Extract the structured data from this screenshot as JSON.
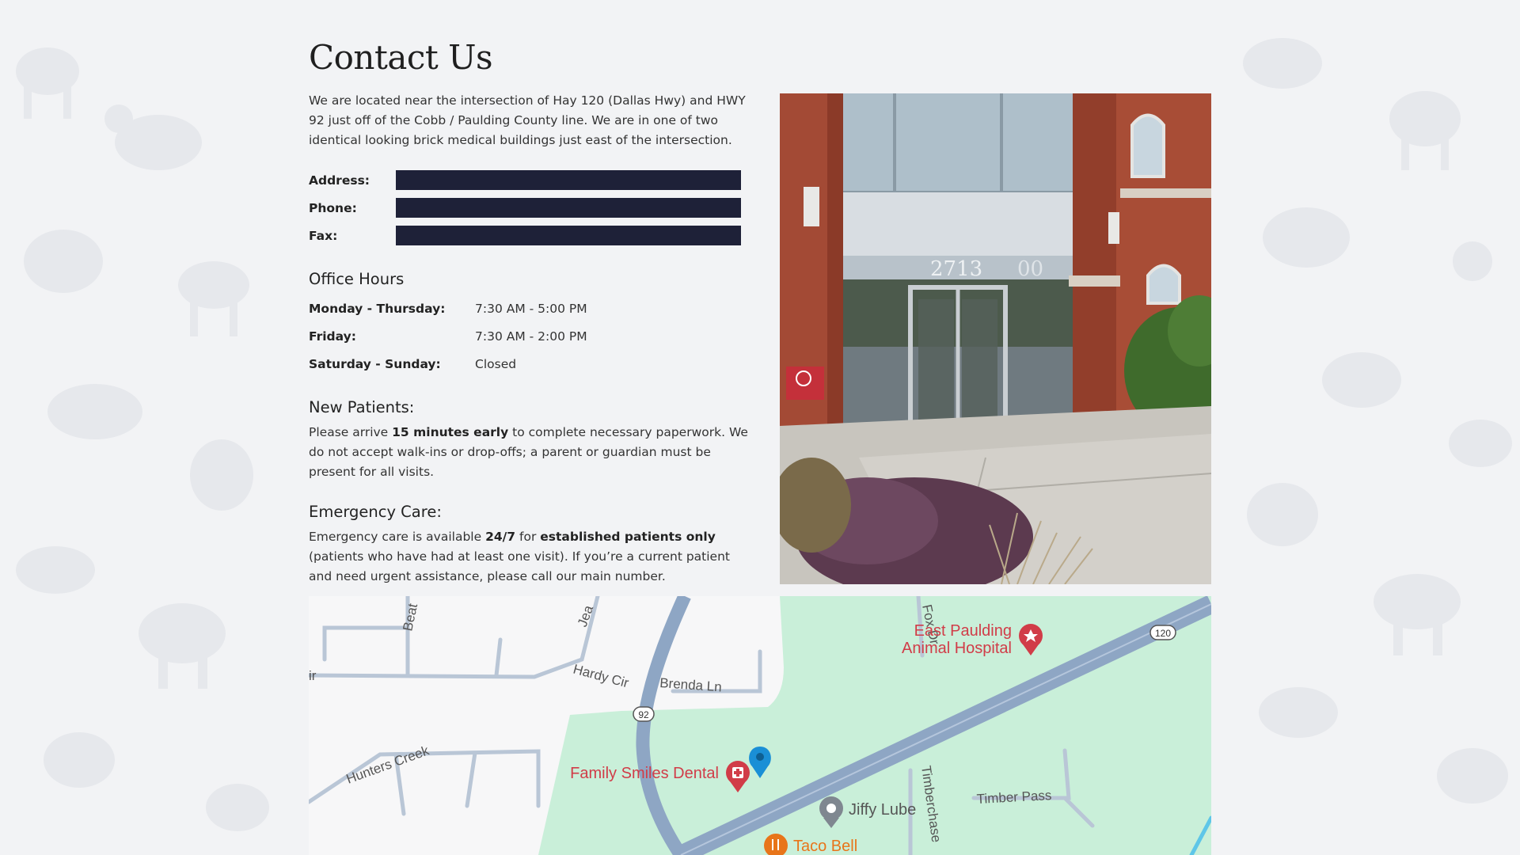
{
  "page": {
    "title": "Contact Us",
    "intro": "We are located near the intersection of Hay 120 (Dallas Hwy) and HWY 92 just off of the Cobb / Paulding County line. We are in one of two identical looking brick medical buildings just east of the intersection."
  },
  "contact": {
    "address_label": "Address:",
    "phone_label": "Phone:",
    "fax_label": "Fax:"
  },
  "office_hours": {
    "heading": "Office Hours",
    "rows": [
      {
        "day": "Monday - Thursday:",
        "time": "7:30 AM - 5:00 PM"
      },
      {
        "day": "Friday:",
        "time": "7:30 AM - 2:00 PM"
      },
      {
        "day": "Saturday - Sunday:",
        "time": "Closed"
      }
    ]
  },
  "new_patients": {
    "heading": "New Patients:",
    "text_1": "Please arrive ",
    "bold_1": "15 minutes early",
    "text_2": " to complete necessary paperwork. We do not accept walk-ins or drop-offs; a parent or guardian must be present for all visits."
  },
  "emergency": {
    "heading": "Emergency Care:",
    "text_1": "Emergency care is available ",
    "bold_1": "24/7",
    "text_2": " for ",
    "bold_2": "established patients only",
    "text_3": " (patients who have had at least one visit). If you’re a current patient and need urgent assistance, please call our main number."
  },
  "photo": {
    "building_number": "2713",
    "building_number_2": "00"
  },
  "map": {
    "places": {
      "animal_hospital": "East Paulding\nAnimal Hospital",
      "animal_hospital_line1": "East Paulding",
      "animal_hospital_line2": "Animal Hospital",
      "dental": "Family Smiles Dental",
      "jiffy": "Jiffy Lube",
      "taco": "Taco Bell"
    },
    "streets": {
      "beat": "Beat",
      "jea": "Jea",
      "fox": "Fox Dr",
      "cir": "ir",
      "hardy": "Hardy Cir",
      "brenda": "Brenda Ln",
      "hunters": "Hunters Creek",
      "timberchase": "Timberchase",
      "timber_pass": "Timber Pass"
    },
    "shields": {
      "hwy120": "120",
      "hwy92": "92"
    }
  },
  "colors": {
    "redacted": "#1e2138",
    "map_green": "#c9efd9",
    "road": "#8ea6c4",
    "poi_red": "#d13c48",
    "pin_blue": "#1a8fd6",
    "taco_orange": "#e8751a"
  }
}
